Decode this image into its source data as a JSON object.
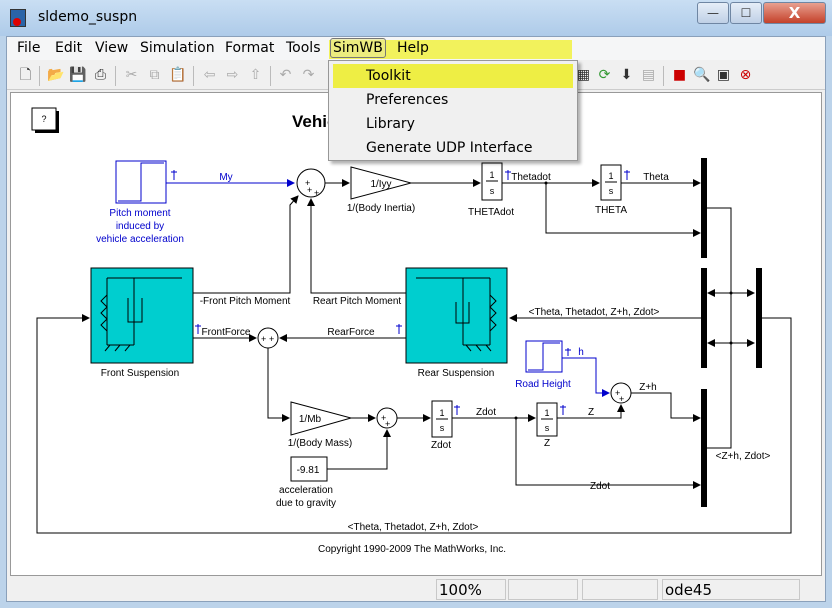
{
  "window": {
    "title": "sldemo_suspn",
    "controls": {
      "minimize": "—",
      "maximize": "☐",
      "close": "X"
    }
  },
  "menubar": [
    "File",
    "Edit",
    "View",
    "Simulation",
    "Format",
    "Tools",
    "SimWB",
    "Help"
  ],
  "simwb_menu": {
    "items": [
      "Toolkit",
      "Preferences",
      "Library",
      "Generate UDP Interface"
    ],
    "highlighted": "Toolkit",
    "highlight_color": "#eeee44"
  },
  "toolbar": [
    "new-icon",
    "open-icon",
    "save-icon",
    "print-icon",
    "cut-icon",
    "copy-icon",
    "paste-icon",
    "back-icon",
    "forward-icon",
    "up-icon",
    "undo-icon",
    "redo-icon",
    "library-icon",
    "refresh-icon",
    "build-icon",
    "debug-icon",
    "model-explorer-icon",
    "find-icon",
    "browser-icon",
    "stop-icon"
  ],
  "diagram": {
    "title": "Vehicle Suspension Model",
    "help_block": "?",
    "block_color": "#00cecf",
    "blocks": {
      "pitch_step": [
        "Pitch moment",
        "induced by",
        "vehicle acceleration"
      ],
      "gain_iyy": "1/Iyy",
      "gain_iyy_label": "1/(Body Inertia)",
      "int_num": "1",
      "int_den": "s",
      "thetadot_label": "THETAdot",
      "theta_label": "THETA",
      "front": "Front Suspension",
      "rear": "Rear Suspension",
      "gain_mb": "1/Mb",
      "gain_mb_label": "1/(Body Mass)",
      "const": "-9.81",
      "const_label": [
        "acceleration",
        "due to gravity"
      ],
      "zdot_label": "Zdot",
      "z_label": "Z",
      "road": "Road Height"
    },
    "signals": {
      "my": "My",
      "thetadot": "Thetadot",
      "theta": "Theta",
      "front_pitch": "-Front Pitch Moment",
      "rear_pitch": "Reart Pitch Moment",
      "front_force": "FrontForce",
      "rear_force": "RearForce",
      "bus": "<Theta, Thetadot, Z+h, Zdot>",
      "h": "h",
      "zh": "Z+h",
      "zdot": "Zdot",
      "z": "Z",
      "zh_zdot": "<Z+h, Zdot>",
      "sum_plus": "+"
    },
    "copyright": "Copyright 1990-2009 The MathWorks, Inc."
  },
  "status": {
    "zoom": "100%",
    "cell2": "",
    "cell3": "",
    "solver": "ode45"
  }
}
